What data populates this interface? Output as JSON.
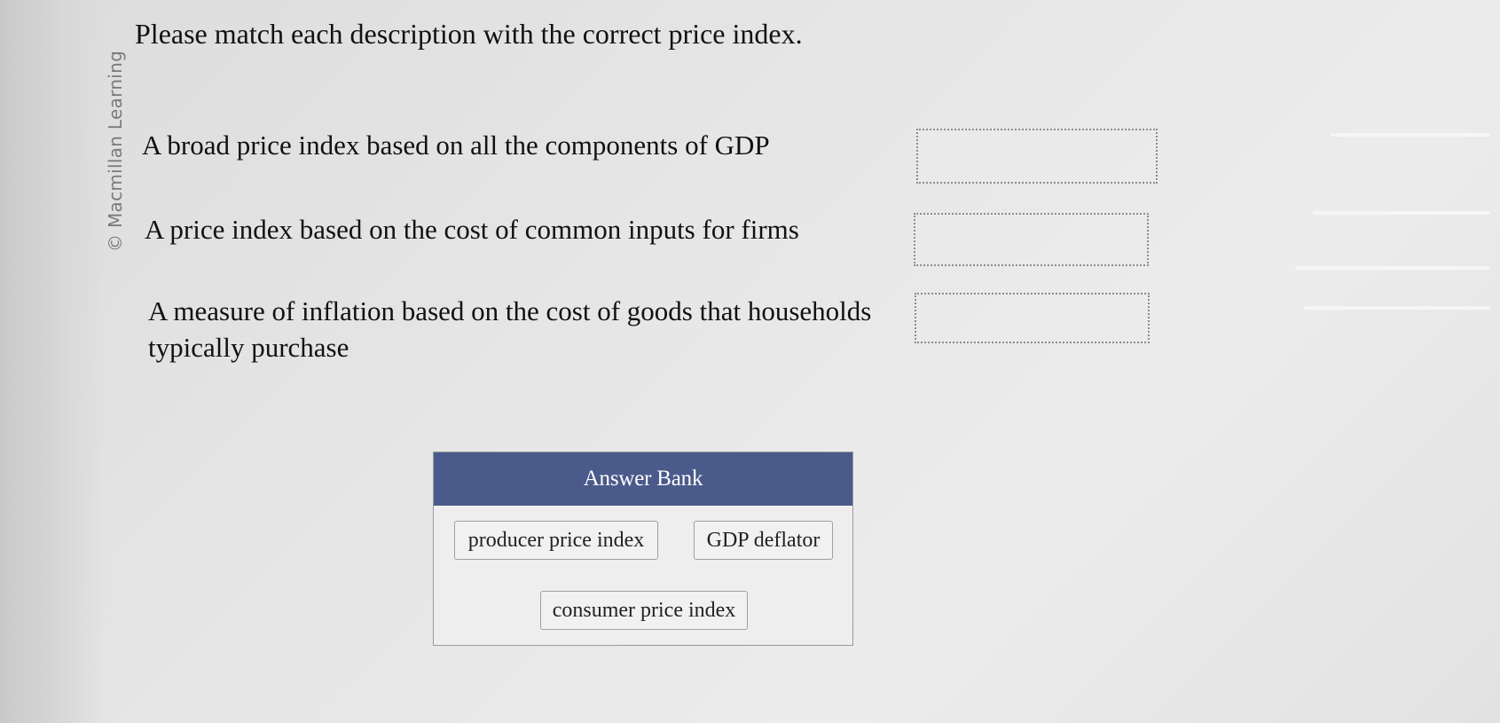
{
  "copyright": "© Macmillan Learning",
  "prompt": "Please match each description with the correct price index.",
  "descriptions": [
    "A broad price index based on all the components of GDP",
    "A price index based on the cost of common inputs for firms",
    "A measure of inflation based on the cost of goods that households typically purchase"
  ],
  "answer_bank": {
    "title": "Answer Bank",
    "options": [
      "producer price index",
      "GDP deflator",
      "consumer price index"
    ]
  }
}
